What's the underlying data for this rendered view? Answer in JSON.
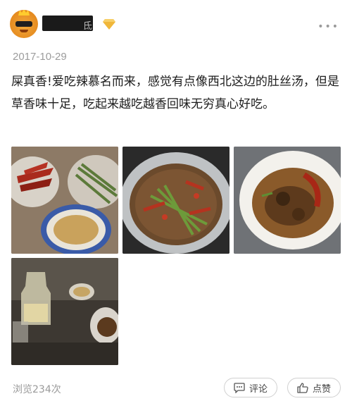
{
  "post": {
    "username_suffix": "氐",
    "date": "2017-10-29",
    "text": "屎真香!爱吃辣慕名而来，感觉有点像西北这边的肚丝汤，但是草香味十足，吃起来越吃越香回味无穷真心好吃。",
    "photos": [
      {
        "alt": "dried red chilies and dipping sauce"
      },
      {
        "alt": "soup with chilies and greens in pot"
      },
      {
        "alt": "bowl of tripe soup with chili"
      },
      {
        "alt": "table with liquor bottle and sauces"
      }
    ]
  },
  "footer": {
    "views": "浏览234次",
    "comment_label": "评论",
    "like_label": "点赞"
  },
  "icons": {
    "more": "more-icon",
    "vip": "diamond-icon",
    "comment": "comment-icon",
    "like": "thumbs-up-icon"
  },
  "colors": {
    "vip": "#f0b73a",
    "date": "#9c9c9c"
  }
}
